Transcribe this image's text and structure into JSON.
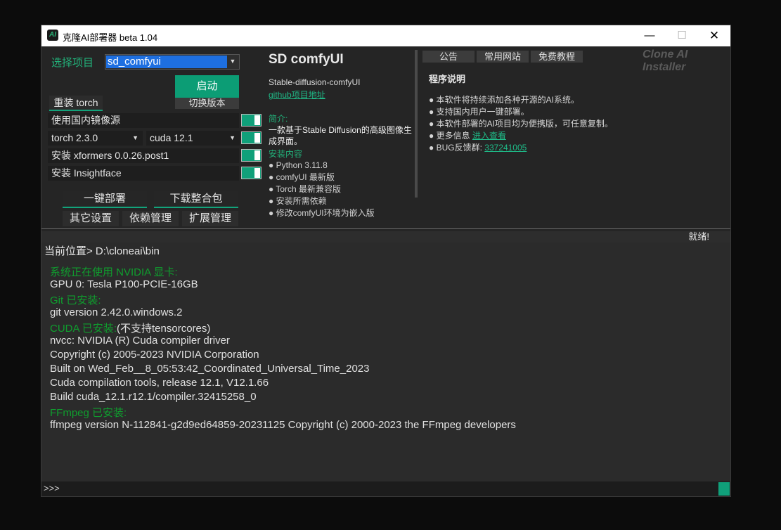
{
  "window": {
    "title": "克隆AI部署器 beta 1.04",
    "icon_label": "AI",
    "controls": {
      "minimize": "—",
      "maximize": "☐",
      "close": "✕"
    }
  },
  "left": {
    "select_project_label": "选择项目",
    "selected_project": "sd_comfyui",
    "start_button": "启动",
    "switch_version_button": "切换版本",
    "reinstall_tab": "重装 torch",
    "options": [
      {
        "label": "使用国内镜像源",
        "enabled": true
      },
      {
        "label": "安装 xformers 0.0.26.post1",
        "enabled": true
      },
      {
        "label": "安装 Insightface",
        "enabled": true
      }
    ],
    "torch_version": "torch 2.3.0",
    "cuda_version": "cuda 12.1",
    "cuda_toggle_enabled": true,
    "deploy_button": "一键部署",
    "download_button": "下载整合包",
    "other_settings": "其它设置",
    "deps_manage": "依赖管理",
    "ext_manage": "扩展管理"
  },
  "middle": {
    "arrow": "⟶",
    "title": "SD comfyUI",
    "subtitle": "Stable-diffusion-comfyUI",
    "github_link": "github项目地址",
    "intro_label": "简介:",
    "intro_text": "一款基于Stable Diffusion的高级图像生成界面。",
    "install_label": "安装内容",
    "install_items": [
      "● Python 3.11.8",
      "● comfyUI 最新版",
      "● Torch 最新兼容版",
      "● 安装所需依赖",
      "● 修改comfyUI环境为嵌入版"
    ]
  },
  "right": {
    "tabs": [
      "公告",
      "常用网站",
      "免费教程"
    ],
    "brand": "Clone AI Installer",
    "info_title": "程序说明",
    "info_lines": [
      "● 本软件将持续添加各种开源的AI系统。",
      "● 支持国内用户一键部署。",
      "● 本软件部署的AI项目均为便携版，可任意复制。"
    ],
    "more_info_prefix": "● 更多信息",
    "more_info_link": "进入查看",
    "bug_prefix": "● BUG反馈群:",
    "bug_link": "337241005"
  },
  "status": {
    "text": "就绪!"
  },
  "console": {
    "cwd": "当前位置> D:\\cloneai\\bin",
    "lines": [
      {
        "green": "系统正在使用 NVIDIA 显卡:",
        "text": ""
      },
      {
        "green": "",
        "text": "GPU 0: Tesla P100-PCIE-16GB"
      },
      {
        "green": "Git 已安装:",
        "text": ""
      },
      {
        "green": "",
        "text": "git version 2.42.0.windows.2"
      },
      {
        "green": "CUDA 已安装:",
        "text": "(不支持tensorcores)"
      },
      {
        "green": "",
        "text": "nvcc: NVIDIA (R) Cuda compiler driver"
      },
      {
        "green": "",
        "text": "Copyright (c) 2005-2023 NVIDIA Corporation"
      },
      {
        "green": "",
        "text": "Built on Wed_Feb__8_05:53:42_Coordinated_Universal_Time_2023"
      },
      {
        "green": "",
        "text": "Cuda compilation tools, release 12.1, V12.1.66"
      },
      {
        "green": "",
        "text": "Build cuda_12.1.r12.1/compiler.32415258_0"
      },
      {
        "green": "FFmpeg 已安装:",
        "text": ""
      },
      {
        "green": "",
        "text": "ffmpeg version N-112841-g2d9ed64859-20231125 Copyright (c) 2000-2023 the FFmpeg developers"
      }
    ],
    "prompt": ">>>"
  },
  "colors": {
    "accent": "#10a07a",
    "select_highlight": "#1e6fe0",
    "console_green": "#0f9e2e"
  }
}
